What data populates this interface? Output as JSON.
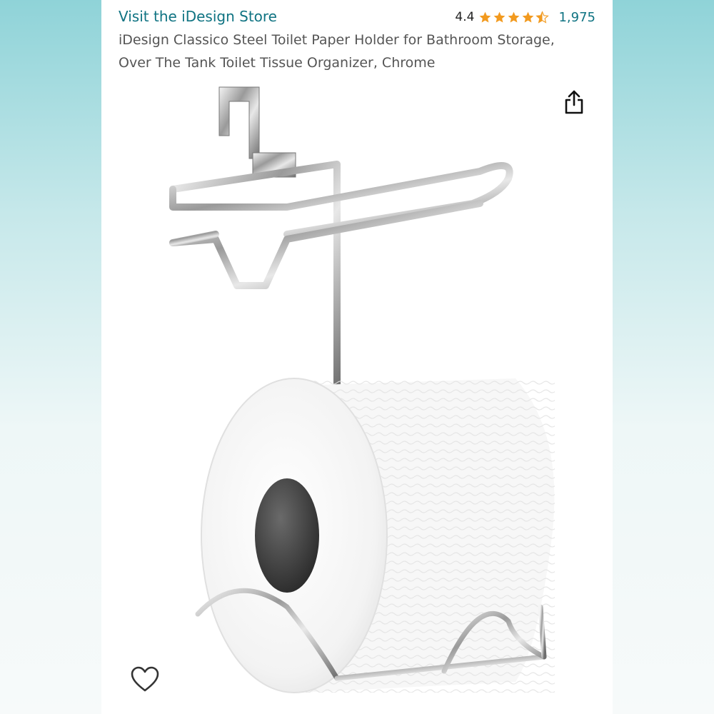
{
  "header": {
    "store_link": "Visit the iDesign Store",
    "rating_value": "4.4",
    "rating_stars": 4.4,
    "rating_count": "1,975"
  },
  "product": {
    "title": "iDesign Classico Steel Toilet Paper Holder for Bathroom Storage, Over The Tank Toilet Tissue Organizer, Chrome"
  },
  "icons": {
    "share": "share-icon",
    "favorite": "heart-icon",
    "star": "star-icon"
  },
  "colors": {
    "link": "#0f7382",
    "star": "#f29a1f",
    "background_teal": "#8fd3d8"
  }
}
